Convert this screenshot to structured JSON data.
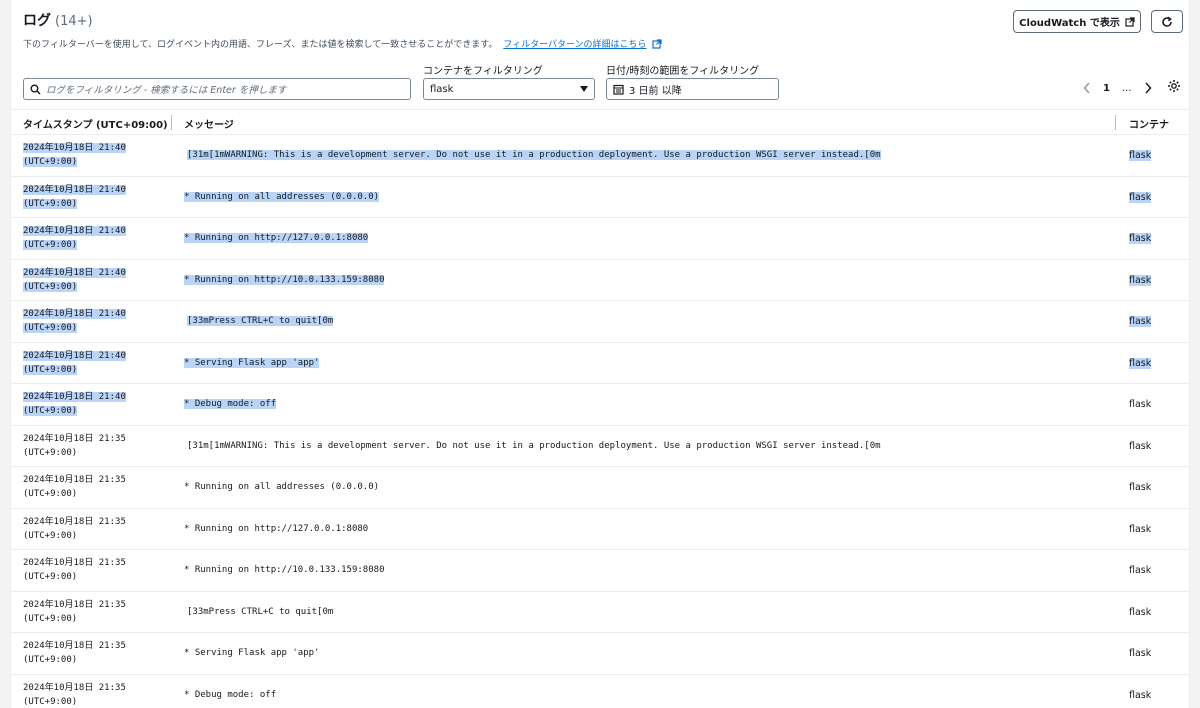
{
  "header": {
    "title": "ログ",
    "count": "(14+)",
    "description": "下のフィルターバーを使用して、ログイベント内の用語、フレーズ、または値を検索して一致させることができます。",
    "pattern_link": "フィルターパターンの詳細はこちら",
    "cloudwatch_button": "CloudWatch で表示"
  },
  "filters": {
    "search_placeholder": "ログをフィルタリング - 検索するには Enter を押します",
    "container_label": "コンテナをフィルタリング",
    "container_value": "flask",
    "date_label": "日付/時刻の範囲をフィルタリング",
    "date_value": "3 日前 以降"
  },
  "pagination": {
    "page": "1",
    "ellipsis": "..."
  },
  "table": {
    "columns": {
      "time": "タイムスタンプ (UTC+09:00)",
      "message": "メッセージ",
      "container": "コンテナ"
    },
    "rows": [
      {
        "date": "2024年10月18日 21:40",
        "tz": "(UTC+9:00)",
        "message": "[31m[1mWARNING: This is a development server. Do not use it in a production deployment. Use a production WSGI server instead.[0m",
        "container": "flask"
      },
      {
        "date": "2024年10月18日 21:40",
        "tz": "(UTC+9:00)",
        "message": "* Running on all addresses (0.0.0.0)",
        "container": "flask"
      },
      {
        "date": "2024年10月18日 21:40",
        "tz": "(UTC+9:00)",
        "message": "* Running on http://127.0.0.1:8080",
        "container": "flask"
      },
      {
        "date": "2024年10月18日 21:40",
        "tz": "(UTC+9:00)",
        "message": "* Running on http://10.0.133.159:8080",
        "container": "flask"
      },
      {
        "date": "2024年10月18日 21:40",
        "tz": "(UTC+9:00)",
        "message": "[33mPress CTRL+C to quit[0m",
        "container": "flask"
      },
      {
        "date": "2024年10月18日 21:40",
        "tz": "(UTC+9:00)",
        "message": "* Serving Flask app 'app'",
        "container": "flask"
      },
      {
        "date": "2024年10月18日 21:40",
        "tz": "(UTC+9:00)",
        "message": "* Debug mode: off",
        "container": "flask"
      },
      {
        "date": "2024年10月18日 21:35",
        "tz": "(UTC+9:00)",
        "message": "[31m[1mWARNING: This is a development server. Do not use it in a production deployment. Use a production WSGI server instead.[0m",
        "container": "flask"
      },
      {
        "date": "2024年10月18日 21:35",
        "tz": "(UTC+9:00)",
        "message": "* Running on all addresses (0.0.0.0)",
        "container": "flask"
      },
      {
        "date": "2024年10月18日 21:35",
        "tz": "(UTC+9:00)",
        "message": "* Running on http://127.0.0.1:8080",
        "container": "flask"
      },
      {
        "date": "2024年10月18日 21:35",
        "tz": "(UTC+9:00)",
        "message": "* Running on http://10.0.133.159:8080",
        "container": "flask"
      },
      {
        "date": "2024年10月18日 21:35",
        "tz": "(UTC+9:00)",
        "message": "[33mPress CTRL+C to quit[0m",
        "container": "flask"
      },
      {
        "date": "2024年10月18日 21:35",
        "tz": "(UTC+9:00)",
        "message": "* Serving Flask app 'app'",
        "container": "flask"
      },
      {
        "date": "2024年10月18日 21:35",
        "tz": "(UTC+9:00)",
        "message": "* Debug mode: off",
        "container": "flask"
      }
    ]
  },
  "icons": {
    "search": "search-icon",
    "external": "external-link-icon",
    "refresh": "refresh-icon",
    "calendar": "calendar-icon",
    "caret": "caret-down-icon",
    "prev": "chevron-left-icon",
    "next": "chevron-right-icon",
    "settings": "gear-icon"
  },
  "colors": {
    "link": "#0972d3",
    "selection": "#b9d4f7",
    "text": "#16191f"
  }
}
